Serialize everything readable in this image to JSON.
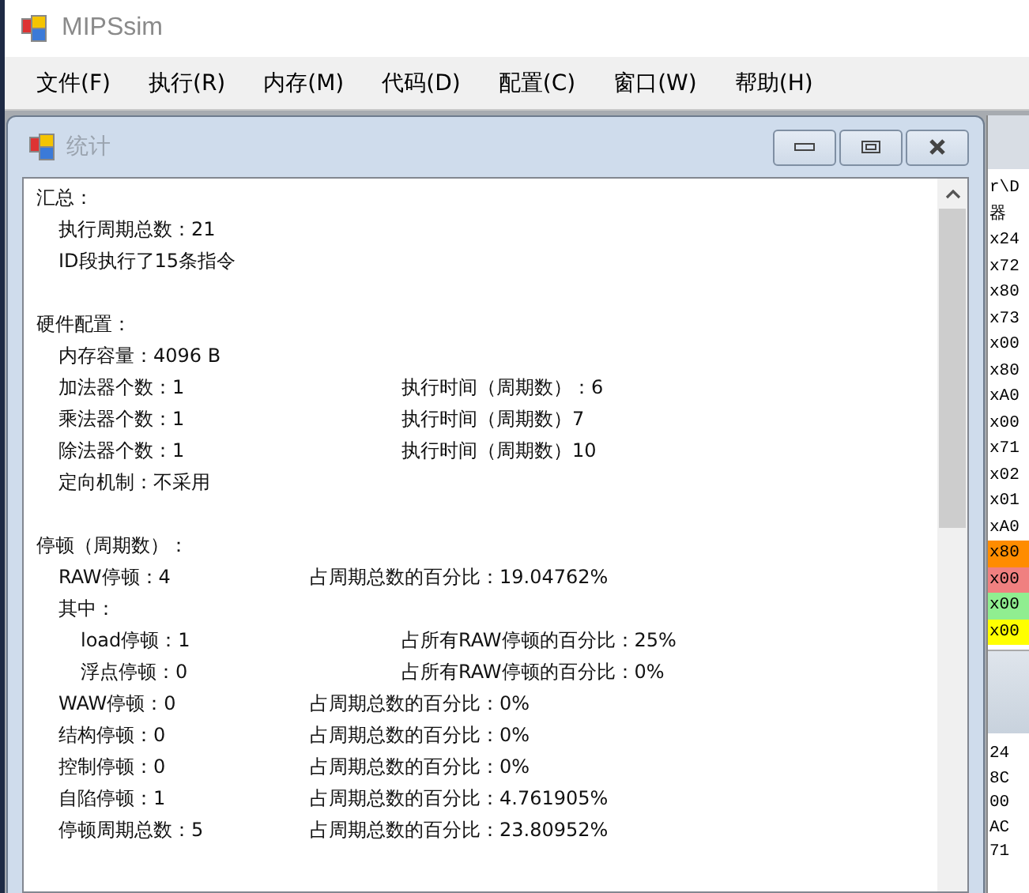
{
  "window": {
    "title": "MIPSsim"
  },
  "menu": [
    {
      "label": "文件(F)"
    },
    {
      "label": "执行(R)"
    },
    {
      "label": "内存(M)"
    },
    {
      "label": "代码(D)"
    },
    {
      "label": "配置(C)"
    },
    {
      "label": "窗口(W)"
    },
    {
      "label": "帮助(H)"
    }
  ],
  "stats_window": {
    "title": "统计",
    "active": false,
    "sections": [
      {
        "title": "汇总：",
        "lines": [
          {
            "kind": "plain",
            "text": "执行周期总数：21"
          },
          {
            "kind": "plain",
            "text": "ID段执行了15条指令"
          }
        ]
      },
      {
        "title": "硬件配置：",
        "lines": [
          {
            "kind": "plain",
            "text": "内存容量：4096 B"
          },
          {
            "kind": "wide",
            "text": "加法器个数：1",
            "note": "执行时间（周期数）：6"
          },
          {
            "kind": "wide",
            "text": "乘法器个数：1",
            "note": "执行时间（周期数）7"
          },
          {
            "kind": "wide",
            "text": "除法器个数：1",
            "note": "执行时间（周期数）10"
          },
          {
            "kind": "plain",
            "text": "定向机制：不采用"
          }
        ]
      },
      {
        "title": "停顿（周期数）：",
        "lines": [
          {
            "kind": "narrow",
            "text": "RAW停顿：4",
            "note": "占周期总数的百分比：19.04762%"
          },
          {
            "kind": "plain",
            "text": "其中：",
            "children": [
              {
                "kind": "wide",
                "text": "load停顿：1",
                "note": "占所有RAW停顿的百分比：25%"
              },
              {
                "kind": "wide",
                "text": "浮点停顿：0",
                "note": "占所有RAW停顿的百分比：0%"
              }
            ]
          },
          {
            "kind": "narrow",
            "text": "WAW停顿：0",
            "note": "占周期总数的百分比：0%"
          },
          {
            "kind": "narrow",
            "text": "结构停顿：0",
            "note": "占周期总数的百分比：0%"
          },
          {
            "kind": "narrow",
            "text": "控制停顿：0",
            "note": "占周期总数的百分比：0%"
          },
          {
            "kind": "narrow",
            "text": "自陷停顿：1",
            "note": "占周期总数的百分比：4.761905%"
          },
          {
            "kind": "narrow",
            "text": "停顿周期总数：5",
            "note": "占周期总数的百分比：23.80952%"
          }
        ]
      }
    ]
  },
  "background_window": {
    "upper_lines": [
      {
        "text": "r\\D"
      },
      {
        "text": "器"
      },
      {
        "text": "x24"
      },
      {
        "text": "x72"
      },
      {
        "text": "x80"
      },
      {
        "text": "x73"
      },
      {
        "text": "x00"
      },
      {
        "text": "x80"
      },
      {
        "text": "xA0"
      },
      {
        "text": "x00"
      },
      {
        "text": "x71"
      },
      {
        "text": "x02"
      },
      {
        "text": "x01"
      },
      {
        "text": "xA0"
      },
      {
        "text": "x80",
        "color": "#ff8c00"
      },
      {
        "text": "x00",
        "color": "#f08080"
      },
      {
        "text": "x00",
        "color": "#90ee90"
      },
      {
        "text": "x00",
        "color": "#ffff00"
      }
    ],
    "lower_lines": [
      {
        "text": "24"
      },
      {
        "text": "8C"
      },
      {
        "text": "00"
      },
      {
        "text": "AC"
      },
      {
        "text": "71"
      }
    ]
  }
}
